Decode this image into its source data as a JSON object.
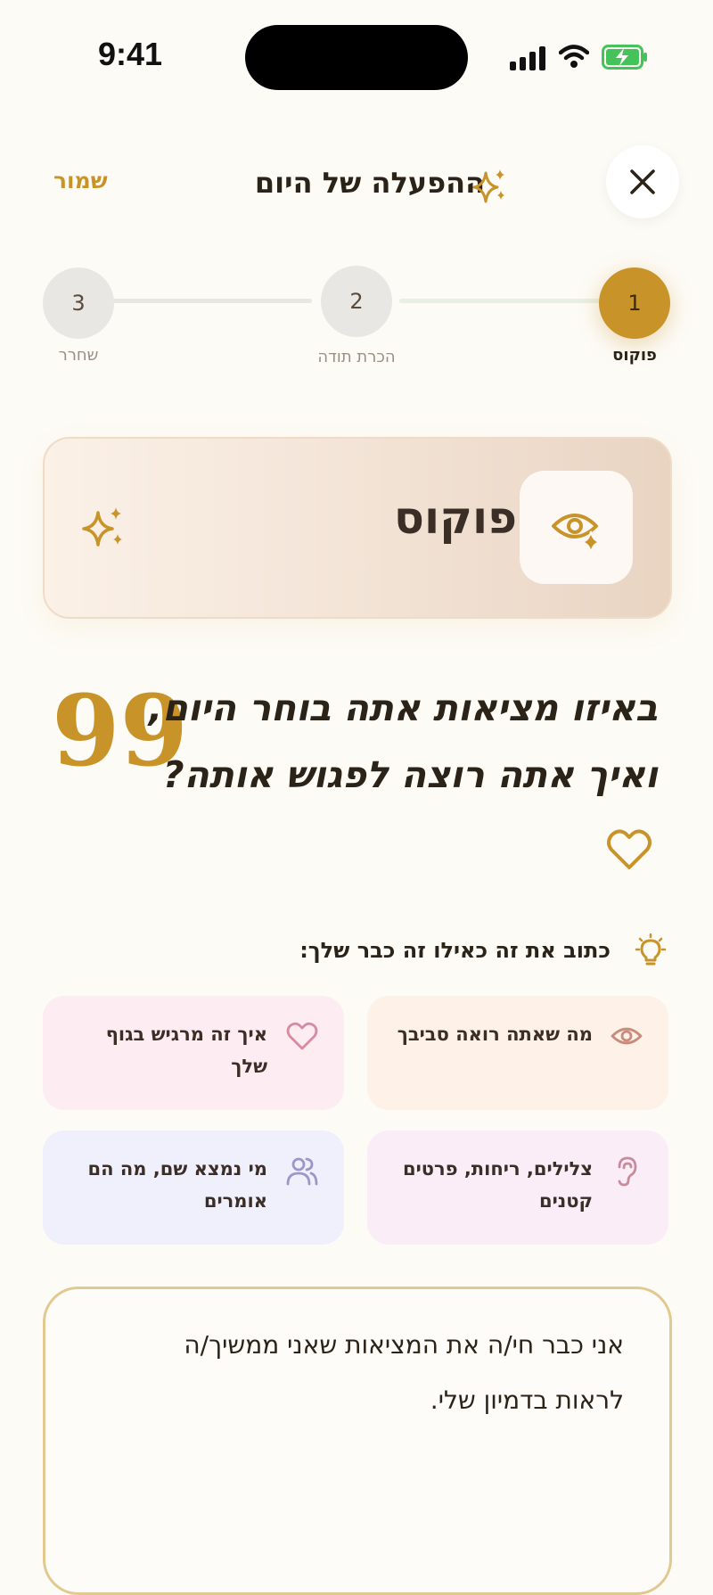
{
  "status_bar": {
    "time": "9:41"
  },
  "header": {
    "title": "ההפעלה של היום",
    "save_label": "שמור"
  },
  "stepper": {
    "steps": [
      {
        "number": "1",
        "label": "פוקוס"
      },
      {
        "number": "2",
        "label": "הכרת תודה"
      },
      {
        "number": "3",
        "label": "שחרר"
      }
    ],
    "active_color": "#c8942a"
  },
  "focus_card": {
    "title": "פוקוס"
  },
  "quote": {
    "line1": "באיזו מציאות אתה בוחר היום,",
    "line2": "ואיך אתה רוצה לפגוש אותה?"
  },
  "tip": {
    "text": "כתוב את זה כאילו זה כבר שלך:"
  },
  "prompt_cards": [
    {
      "text": "מה שאתה רואה סביבך",
      "icon": "eye-icon"
    },
    {
      "text": "איך זה מרגיש בגוף שלך",
      "icon": "heart-icon"
    },
    {
      "text": "צלילים, ריחות, פרטים קטנים",
      "icon": "ear-icon"
    },
    {
      "text": "מי נמצא שם, מה הם אומרים",
      "icon": "people-icon"
    }
  ],
  "answer": {
    "line1": "אני כבר חי/ה את המציאות שאני ממשיך/ה",
    "line2": "לראות בדמיון שלי."
  }
}
